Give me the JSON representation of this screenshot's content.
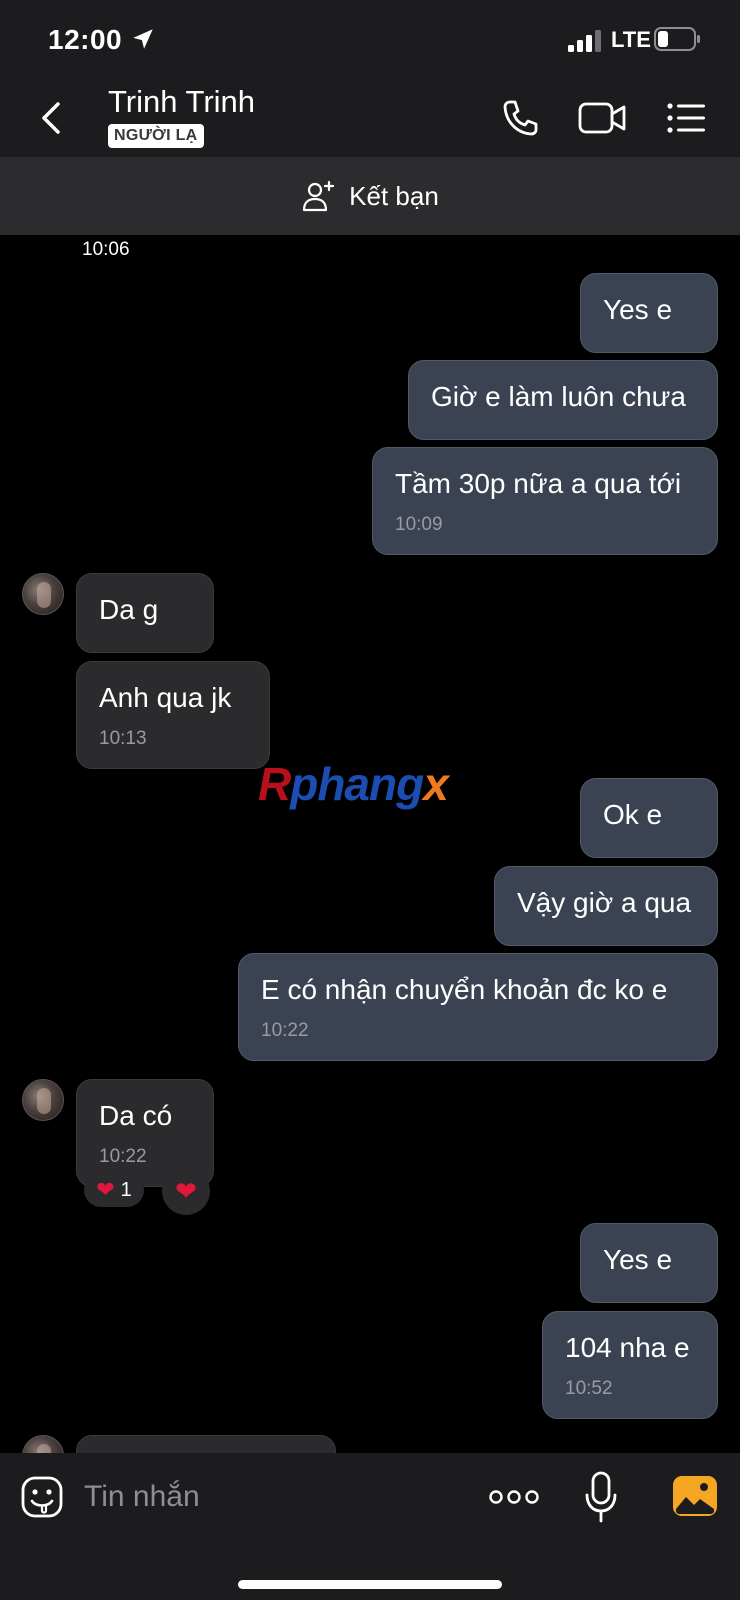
{
  "status_bar": {
    "time": "12:00",
    "network": "LTE"
  },
  "header": {
    "contact_name": "Trinh Trinh",
    "badge": "NGƯỜI LẠ"
  },
  "add_friend": {
    "label": "Kết bạn"
  },
  "chat": {
    "first_time": "10:06",
    "messages": [
      {
        "dir": "out",
        "text": "Yes e"
      },
      {
        "dir": "out",
        "text": "Giờ e làm luôn chưa"
      },
      {
        "dir": "out",
        "text": "Tầm 30p nữa a qua tới",
        "time": "10:09"
      },
      {
        "dir": "in",
        "text": "Da g"
      },
      {
        "dir": "in",
        "text": "Anh qua jk",
        "time": "10:13"
      },
      {
        "dir": "out",
        "text": "Ok e"
      },
      {
        "dir": "out",
        "text": "Vậy giờ a qua"
      },
      {
        "dir": "out",
        "text": "E có nhận chuyển khoản đc ko e",
        "time": "10:22"
      },
      {
        "dir": "in",
        "text": "Da có",
        "time": "10:22",
        "reaction": {
          "emoji": "❤",
          "count": "1"
        }
      },
      {
        "dir": "out",
        "text": "Yes e"
      },
      {
        "dir": "out",
        "text": "104 nha e",
        "time": "10:52"
      }
    ],
    "watermark": {
      "part1": "R",
      "part2": "phang",
      "part3": "x"
    }
  },
  "input_bar": {
    "placeholder": "Tin nhắn"
  },
  "colors": {
    "outgoing_bubble": "#3b4251",
    "incoming_bubble": "#2b2b2d",
    "reaction_heart": "#e3163b",
    "photo_button": "#f5a623"
  }
}
